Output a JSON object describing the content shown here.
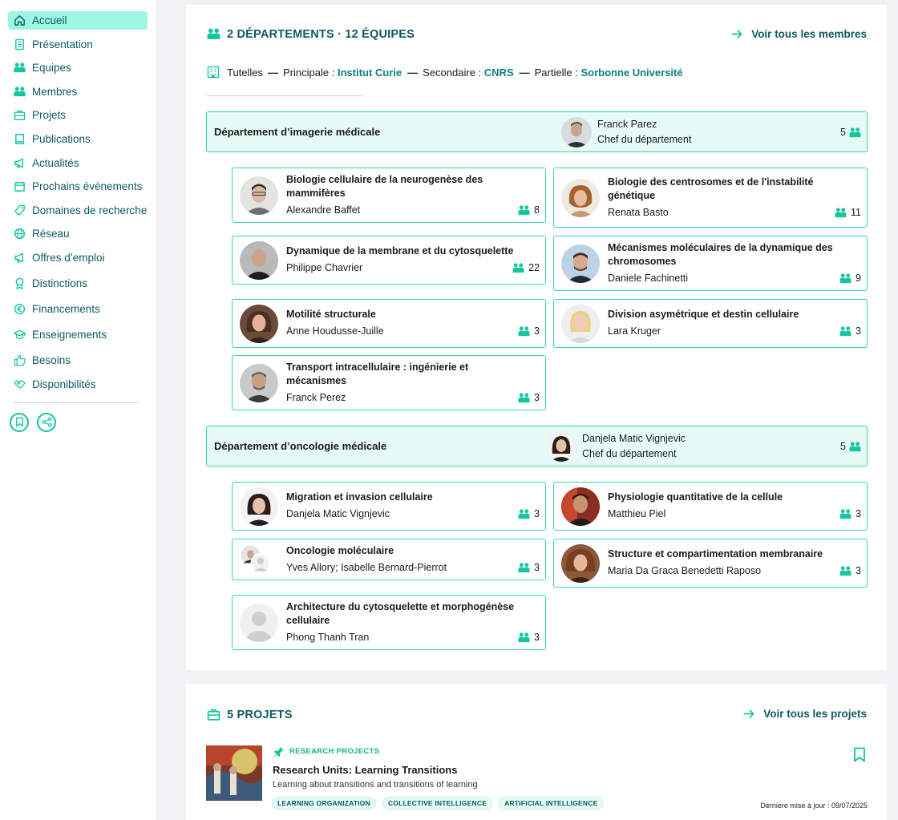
{
  "sidebar": {
    "items": [
      {
        "label": "Accueil",
        "icon": "home-icon",
        "active": true
      },
      {
        "label": "Présentation",
        "icon": "document-icon"
      },
      {
        "label": "Equipes",
        "icon": "people-icon"
      },
      {
        "label": "Membres",
        "icon": "people-icon"
      },
      {
        "label": "Projets",
        "icon": "briefcase-icon"
      },
      {
        "label": "Publications",
        "icon": "book-icon"
      },
      {
        "label": "Actualités",
        "icon": "megaphone-icon"
      },
      {
        "label": "Prochains événements",
        "icon": "calendar-icon"
      },
      {
        "label": "Domaines de recherche",
        "icon": "tag-icon"
      },
      {
        "label": "Réseau",
        "icon": "globe-icon"
      },
      {
        "label": "Offres d’emploi",
        "icon": "megaphone-icon"
      },
      {
        "label": "Distinctions",
        "icon": "award-icon"
      },
      {
        "label": "Financements",
        "icon": "euro-icon"
      },
      {
        "label": "Enseignements",
        "icon": "graduation-cap-icon"
      },
      {
        "label": "Besoins",
        "icon": "thumbs-up-icon"
      },
      {
        "label": "Disponibilités",
        "icon": "handshake-icon"
      }
    ],
    "actions": [
      "bookmark-icon",
      "share-icon"
    ]
  },
  "teams_section": {
    "heading": "2 DÉPARTEMENTS · 12 ÉQUIPES",
    "link": "Voir tous les membres",
    "tutelles": {
      "label": "Tutelles",
      "principale_label": "Principale :",
      "principale": "Institut Curie",
      "secondaire_label": "Secondaire :",
      "secondaire": "CNRS",
      "partielle_label": "Partielle :",
      "partielle": "Sorbonne Université"
    },
    "departments": [
      {
        "title": "Département d’imagerie médicale",
        "chef_name": "Franck Parez",
        "chef_role": "Chef du département",
        "count": "5",
        "teams": [
          {
            "title": "Biologie cellulaire de la neurogenèse des mammifères",
            "leader": "Alexandre Baffet",
            "count": "8"
          },
          {
            "title": "Biologie des centrosomes et de l'instabilité génétique",
            "leader": "Renata Basto",
            "count": "11"
          },
          {
            "title": "Dynamique de la membrane et du cytosquelette",
            "leader": "Philippe Chavrier",
            "count": "22"
          },
          {
            "title": "Mécanismes moléculaires de la dynamique des chromosomes",
            "leader": "Daniele Fachinetti",
            "count": "9"
          },
          {
            "title": "Motilité structurale",
            "leader": "Anne Houdusse-Juille",
            "count": "3"
          },
          {
            "title": "Division asymétrique et destin cellulaire",
            "leader": "Lara Kruger",
            "count": "3"
          },
          {
            "title": "Transport intracellulaire : ingénierie et mécanismes",
            "leader": "Franck Perez",
            "count": "3"
          }
        ]
      },
      {
        "title": "Département d’oncologie médicale",
        "chef_name": "Danjela Matic Vignjevic",
        "chef_role": "Chef du département",
        "count": "5",
        "teams": [
          {
            "title": "Migration et invasion cellulaire",
            "leader": "Danjela Matic Vignjevic",
            "count": "3"
          },
          {
            "title": "Physiologie quantitative de la cellule",
            "leader": "Matthieu Piel",
            "count": "3"
          },
          {
            "title": "Oncologie moléculaire",
            "leader": "Yves Allory; Isabelle Bernard-Pierrot",
            "count": "3"
          },
          {
            "title": "Structure et compartimentation membranaire",
            "leader": "Maria Da Graca Benedetti Raposo",
            "count": "3"
          },
          {
            "title": "Architecture du cytosquelette et morphogénèse cellulaire",
            "leader": "Phong Thanh Tran",
            "count": "3"
          }
        ]
      }
    ]
  },
  "projects_section": {
    "heading": "5 PROJETS",
    "link": "Voir tous les projets",
    "project": {
      "category": "RESEARCH PROJECTS",
      "title": "Research Units: Learning Transitions",
      "description": "Learning about transitions and transitions of learning",
      "tags": [
        "LEARNING ORGANIZATION",
        "COLLECTIVE INTELLIGENCE",
        "ARTIFICIAL INTELLIGENCE"
      ],
      "updated": "Dernière mise à jour : 09/07/2025"
    }
  },
  "colors": {
    "accent": "#12c7a0",
    "dark_teal": "#0d5a63",
    "link_teal": "#0d7e86",
    "active_bg": "#9ef5e1",
    "dept_bg": "#e6fbf6"
  }
}
